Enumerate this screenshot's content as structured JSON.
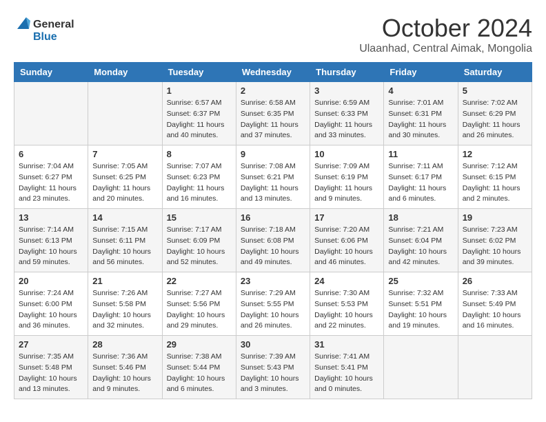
{
  "header": {
    "logo_general": "General",
    "logo_blue": "Blue",
    "month_title": "October 2024",
    "subtitle": "Ulaanhad, Central Aimak, Mongolia"
  },
  "days_of_week": [
    "Sunday",
    "Monday",
    "Tuesday",
    "Wednesday",
    "Thursday",
    "Friday",
    "Saturday"
  ],
  "weeks": [
    [
      {
        "day": "",
        "info": ""
      },
      {
        "day": "",
        "info": ""
      },
      {
        "day": "1",
        "info": "Sunrise: 6:57 AM\nSunset: 6:37 PM\nDaylight: 11 hours and 40 minutes."
      },
      {
        "day": "2",
        "info": "Sunrise: 6:58 AM\nSunset: 6:35 PM\nDaylight: 11 hours and 37 minutes."
      },
      {
        "day": "3",
        "info": "Sunrise: 6:59 AM\nSunset: 6:33 PM\nDaylight: 11 hours and 33 minutes."
      },
      {
        "day": "4",
        "info": "Sunrise: 7:01 AM\nSunset: 6:31 PM\nDaylight: 11 hours and 30 minutes."
      },
      {
        "day": "5",
        "info": "Sunrise: 7:02 AM\nSunset: 6:29 PM\nDaylight: 11 hours and 26 minutes."
      }
    ],
    [
      {
        "day": "6",
        "info": "Sunrise: 7:04 AM\nSunset: 6:27 PM\nDaylight: 11 hours and 23 minutes."
      },
      {
        "day": "7",
        "info": "Sunrise: 7:05 AM\nSunset: 6:25 PM\nDaylight: 11 hours and 20 minutes."
      },
      {
        "day": "8",
        "info": "Sunrise: 7:07 AM\nSunset: 6:23 PM\nDaylight: 11 hours and 16 minutes."
      },
      {
        "day": "9",
        "info": "Sunrise: 7:08 AM\nSunset: 6:21 PM\nDaylight: 11 hours and 13 minutes."
      },
      {
        "day": "10",
        "info": "Sunrise: 7:09 AM\nSunset: 6:19 PM\nDaylight: 11 hours and 9 minutes."
      },
      {
        "day": "11",
        "info": "Sunrise: 7:11 AM\nSunset: 6:17 PM\nDaylight: 11 hours and 6 minutes."
      },
      {
        "day": "12",
        "info": "Sunrise: 7:12 AM\nSunset: 6:15 PM\nDaylight: 11 hours and 2 minutes."
      }
    ],
    [
      {
        "day": "13",
        "info": "Sunrise: 7:14 AM\nSunset: 6:13 PM\nDaylight: 10 hours and 59 minutes."
      },
      {
        "day": "14",
        "info": "Sunrise: 7:15 AM\nSunset: 6:11 PM\nDaylight: 10 hours and 56 minutes."
      },
      {
        "day": "15",
        "info": "Sunrise: 7:17 AM\nSunset: 6:09 PM\nDaylight: 10 hours and 52 minutes."
      },
      {
        "day": "16",
        "info": "Sunrise: 7:18 AM\nSunset: 6:08 PM\nDaylight: 10 hours and 49 minutes."
      },
      {
        "day": "17",
        "info": "Sunrise: 7:20 AM\nSunset: 6:06 PM\nDaylight: 10 hours and 46 minutes."
      },
      {
        "day": "18",
        "info": "Sunrise: 7:21 AM\nSunset: 6:04 PM\nDaylight: 10 hours and 42 minutes."
      },
      {
        "day": "19",
        "info": "Sunrise: 7:23 AM\nSunset: 6:02 PM\nDaylight: 10 hours and 39 minutes."
      }
    ],
    [
      {
        "day": "20",
        "info": "Sunrise: 7:24 AM\nSunset: 6:00 PM\nDaylight: 10 hours and 36 minutes."
      },
      {
        "day": "21",
        "info": "Sunrise: 7:26 AM\nSunset: 5:58 PM\nDaylight: 10 hours and 32 minutes."
      },
      {
        "day": "22",
        "info": "Sunrise: 7:27 AM\nSunset: 5:56 PM\nDaylight: 10 hours and 29 minutes."
      },
      {
        "day": "23",
        "info": "Sunrise: 7:29 AM\nSunset: 5:55 PM\nDaylight: 10 hours and 26 minutes."
      },
      {
        "day": "24",
        "info": "Sunrise: 7:30 AM\nSunset: 5:53 PM\nDaylight: 10 hours and 22 minutes."
      },
      {
        "day": "25",
        "info": "Sunrise: 7:32 AM\nSunset: 5:51 PM\nDaylight: 10 hours and 19 minutes."
      },
      {
        "day": "26",
        "info": "Sunrise: 7:33 AM\nSunset: 5:49 PM\nDaylight: 10 hours and 16 minutes."
      }
    ],
    [
      {
        "day": "27",
        "info": "Sunrise: 7:35 AM\nSunset: 5:48 PM\nDaylight: 10 hours and 13 minutes."
      },
      {
        "day": "28",
        "info": "Sunrise: 7:36 AM\nSunset: 5:46 PM\nDaylight: 10 hours and 9 minutes."
      },
      {
        "day": "29",
        "info": "Sunrise: 7:38 AM\nSunset: 5:44 PM\nDaylight: 10 hours and 6 minutes."
      },
      {
        "day": "30",
        "info": "Sunrise: 7:39 AM\nSunset: 5:43 PM\nDaylight: 10 hours and 3 minutes."
      },
      {
        "day": "31",
        "info": "Sunrise: 7:41 AM\nSunset: 5:41 PM\nDaylight: 10 hours and 0 minutes."
      },
      {
        "day": "",
        "info": ""
      },
      {
        "day": "",
        "info": ""
      }
    ]
  ]
}
